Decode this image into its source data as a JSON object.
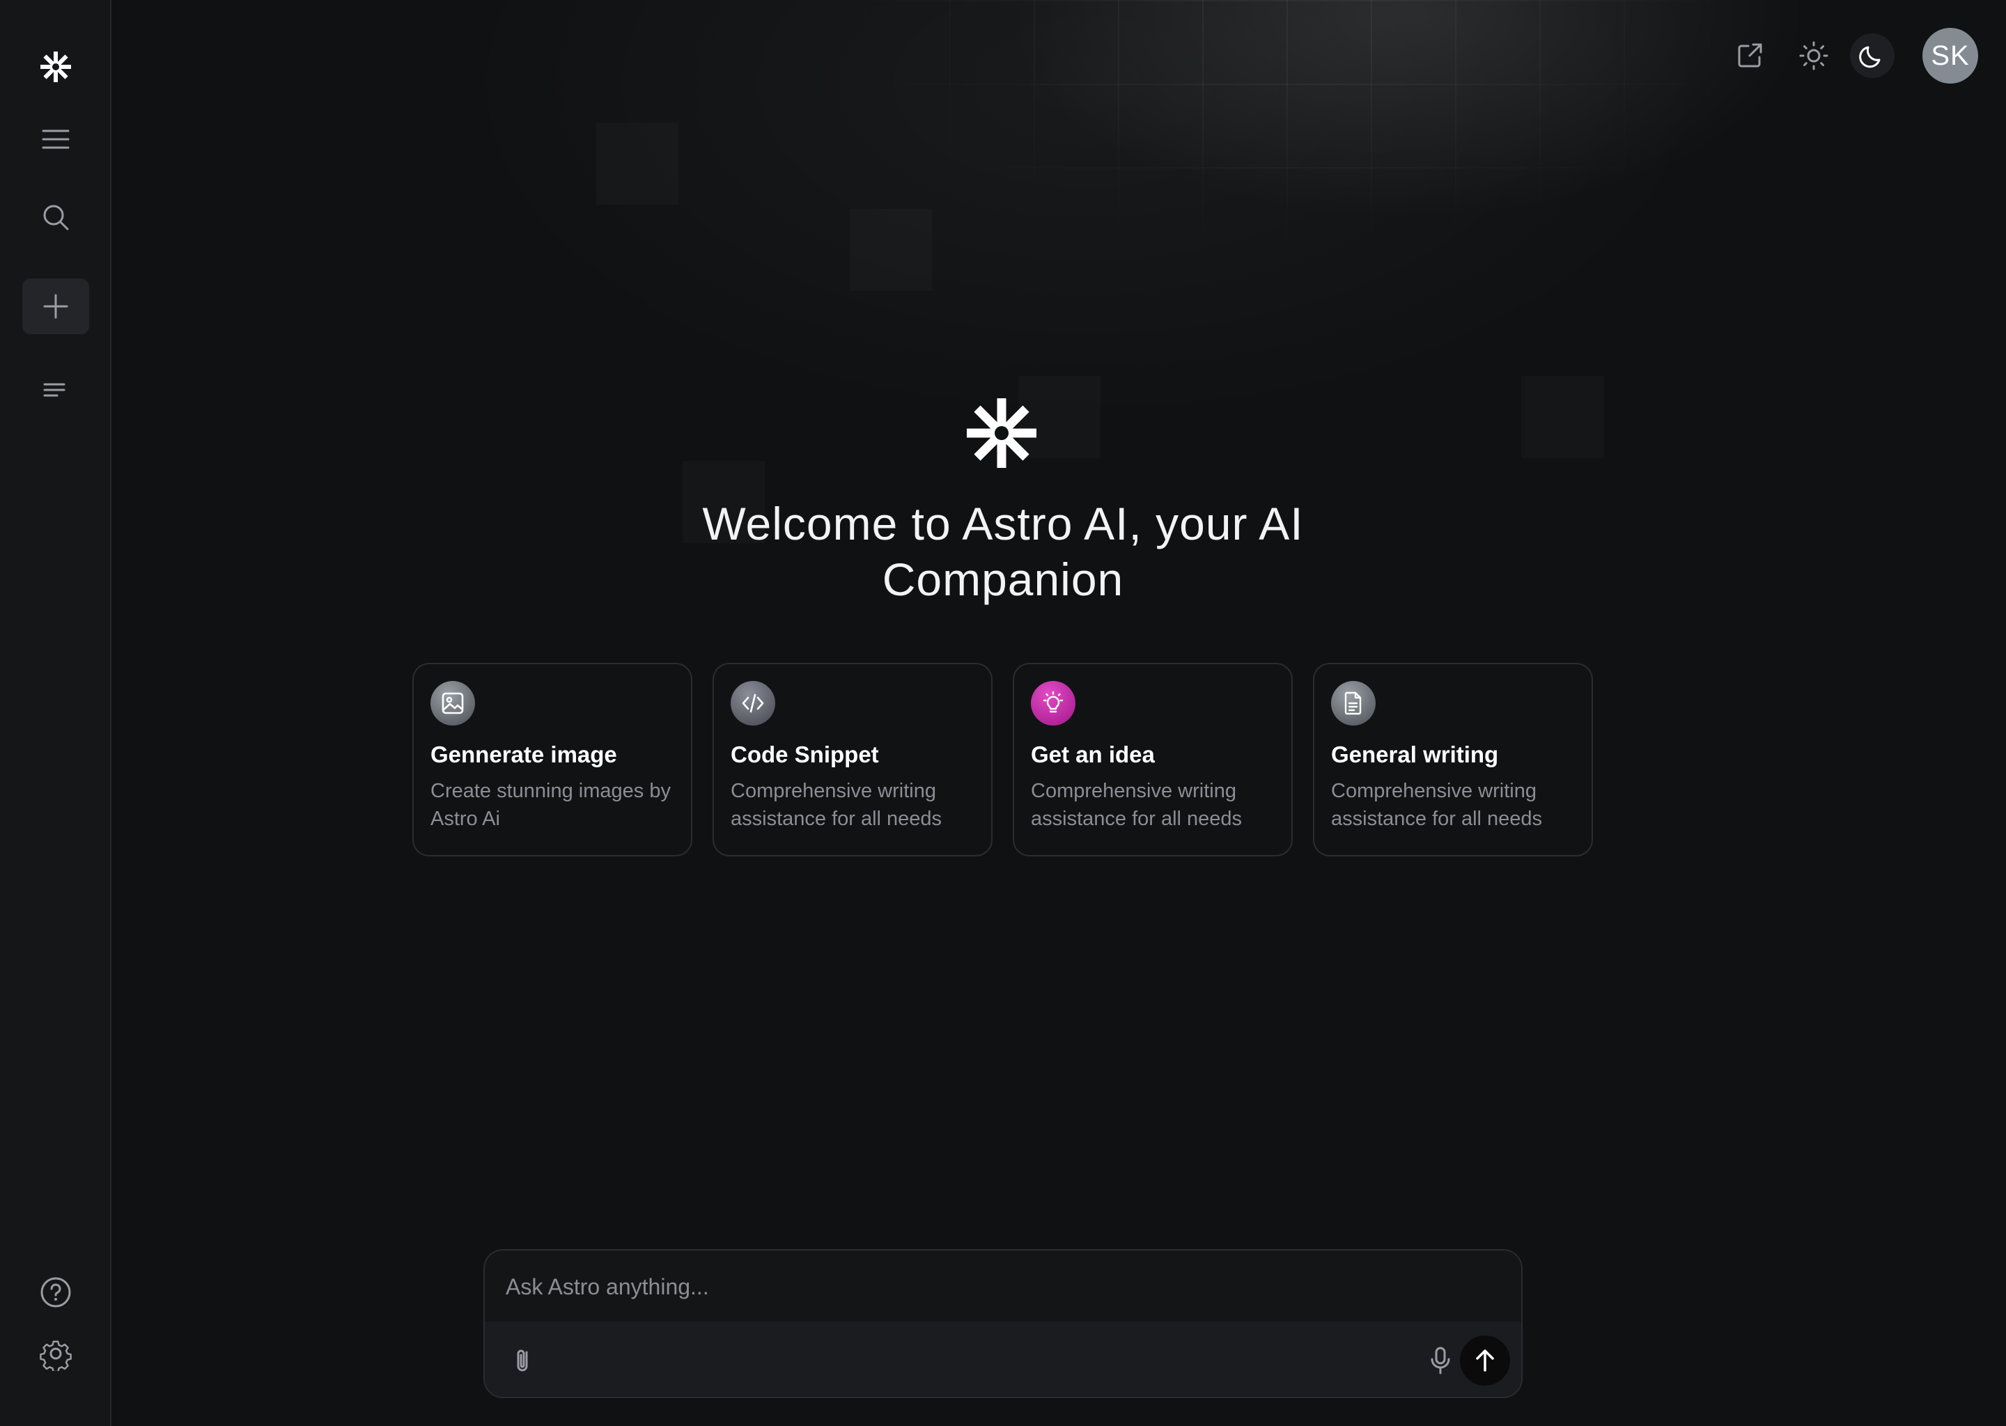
{
  "app": {
    "name": "Astro AI"
  },
  "sidebar": {
    "items": [
      {
        "name": "logo",
        "icon": "asterisk-logo-icon"
      },
      {
        "name": "menu",
        "icon": "menu-icon"
      },
      {
        "name": "search",
        "icon": "search-icon"
      },
      {
        "name": "new-chat",
        "icon": "plus-icon",
        "active": true
      },
      {
        "name": "history",
        "icon": "list-icon"
      }
    ],
    "bottom": [
      {
        "name": "help",
        "icon": "help-circle-icon"
      },
      {
        "name": "settings",
        "icon": "gear-icon"
      }
    ]
  },
  "topbar": {
    "share_icon": "share-icon",
    "light_icon": "sun-icon",
    "dark_icon": "moon-icon",
    "avatar_initials": "SK"
  },
  "hero": {
    "title_line1": "Welcome to Astro AI, your AI",
    "title_line2": "Companion"
  },
  "cards": [
    {
      "title": "Gennerate image",
      "desc_line1": "Create stunning images by",
      "desc_line2": "Astro Ai",
      "icon": "image-icon",
      "accent": "#6b7076"
    },
    {
      "title": "Code Snippet",
      "desc_line1": "Comprehensive writing",
      "desc_line2": "assistance for all needs",
      "icon": "code-icon",
      "accent": "#5a5d66"
    },
    {
      "title": "Get an idea",
      "desc_line1": "Comprehensive writing",
      "desc_line2": "assistance for all needs",
      "icon": "lightbulb-icon",
      "accent": "#c026a3"
    },
    {
      "title": "General writing",
      "desc_line1": "Comprehensive writing",
      "desc_line2": "assistance for all needs",
      "icon": "document-icon",
      "accent": "#6b7076"
    }
  ],
  "composer": {
    "placeholder": "Ask Astro anything...",
    "attach_icon": "paperclip-icon",
    "mic_icon": "microphone-icon",
    "send_icon": "arrow-up-icon"
  },
  "colors": {
    "background": "#101113",
    "sidebar": "#151618",
    "card_border": "#2a2c30",
    "muted_text": "#8b8e94",
    "idea_accent": "#c026a3"
  }
}
